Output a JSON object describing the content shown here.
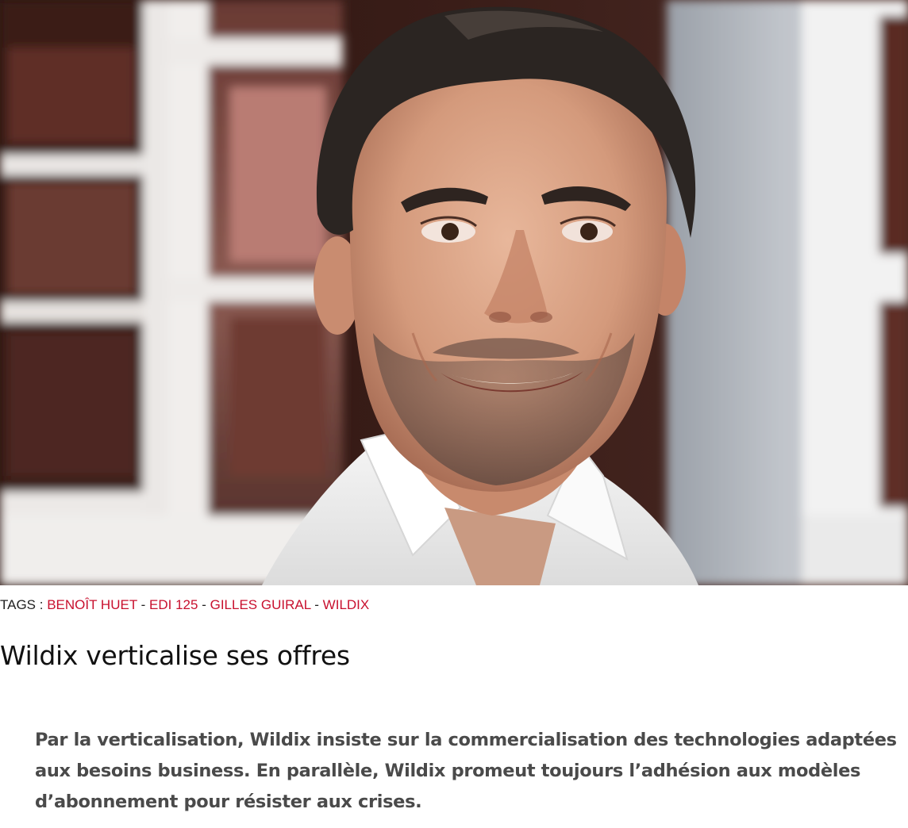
{
  "hero": {
    "image_alt": "photo-portrait"
  },
  "tags": {
    "label": "TAGS :",
    "items": [
      {
        "label": "BENOÎT HUET"
      },
      {
        "label": "EDI 125"
      },
      {
        "label": "GILLES GUIRAL"
      },
      {
        "label": "WILDIX"
      }
    ],
    "separator": "-",
    "link_color": "#c8102e"
  },
  "article": {
    "title": "Wildix verticalise ses offres",
    "lead": "Par la verticalisation, Wildix insiste sur la commercialisation des technologies adaptées aux besoins business. En parallèle, Wildix promeut toujours l’adhésion aux modèles d’abonnement pour résister aux crises."
  }
}
